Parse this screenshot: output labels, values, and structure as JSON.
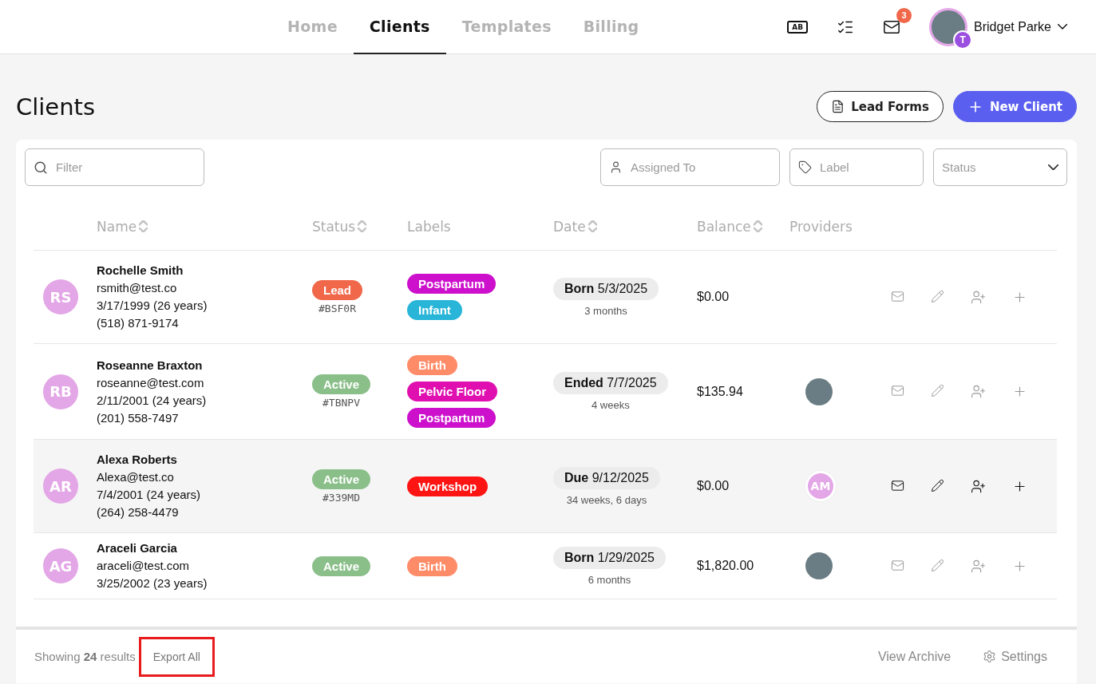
{
  "nav": {
    "tabs": [
      {
        "label": "Home",
        "selected": false
      },
      {
        "label": "Clients",
        "selected": true
      },
      {
        "label": "Templates",
        "selected": false
      },
      {
        "label": "Billing",
        "selected": false
      }
    ],
    "ab_icon_label": "AB",
    "mail_badge": "3",
    "user": {
      "name": "Bridget Parke",
      "badge": "T"
    }
  },
  "page": {
    "title": "Clients",
    "buttons": [
      {
        "label": "Lead Forms",
        "kind": "outline"
      },
      {
        "label": "New Client",
        "kind": "primary"
      }
    ]
  },
  "filters": {
    "search": {
      "placeholder": "Filter"
    },
    "assigned_to": {
      "placeholder": "Assigned To"
    },
    "label": {
      "placeholder": "Label"
    },
    "status": {
      "placeholder": "Status"
    }
  },
  "table": {
    "columns": [
      {
        "label": "Name",
        "sortable": true
      },
      {
        "label": "Status",
        "sortable": true
      },
      {
        "label": "Labels",
        "sortable": false
      },
      {
        "label": "Date",
        "sortable": true
      },
      {
        "label": "Balance",
        "sortable": true
      },
      {
        "label": "Providers",
        "sortable": false
      }
    ],
    "rows": [
      {
        "initials": "RS",
        "name": "Rochelle Smith",
        "email": "rsmith@test.co",
        "birth": "3/17/1999 (26 years)",
        "phone": "(518) 871-9174",
        "status": {
          "label": "Lead",
          "color": "#f0674a",
          "code": "#BSF0R"
        },
        "labels": [
          {
            "label": "Postpartum",
            "color": "#cc10cc"
          },
          {
            "label": "Infant",
            "color": "#28b5d8"
          }
        ],
        "date": {
          "kind": "Born",
          "value": "5/3/2025",
          "relative": "3 months"
        },
        "balance": "$0.00",
        "providers": [],
        "hovered": false
      },
      {
        "initials": "RB",
        "name": "Roseanne Braxton",
        "email": "roseanne@test.com",
        "birth": "2/11/2001 (24 years)",
        "phone": "(201) 558-7497",
        "status": {
          "label": "Active",
          "color": "#8bbf8a",
          "code": "#TBNPV"
        },
        "labels": [
          {
            "label": "Birth",
            "color": "#ff8c69"
          },
          {
            "label": "Pelvic Floor",
            "color": "#e010b0"
          },
          {
            "label": "Postpartum",
            "color": "#cc10cc"
          }
        ],
        "date": {
          "kind": "Ended",
          "value": "7/7/2025",
          "relative": "4 weeks"
        },
        "balance": "$135.94",
        "providers": [
          {
            "kind": "photo"
          }
        ],
        "hovered": false
      },
      {
        "initials": "AR",
        "name": "Alexa Roberts",
        "email": "Alexa@test.co",
        "birth": "7/4/2001 (24 years)",
        "phone": "(264) 258-4479",
        "status": {
          "label": "Active",
          "color": "#8bbf8a",
          "code": "#339MD"
        },
        "labels": [
          {
            "label": "Workshop",
            "color": "#ff1414"
          }
        ],
        "date": {
          "kind": "Due",
          "value": "9/12/2025",
          "relative": "34 weeks, 6 days"
        },
        "balance": "$0.00",
        "providers": [
          {
            "kind": "initials",
            "initials": "AM"
          }
        ],
        "hovered": true
      },
      {
        "initials": "AG",
        "name": "Araceli Garcia",
        "email": "araceli@test.com",
        "birth": "3/25/2002 (23 years)",
        "status": {
          "label": "Active",
          "color": "#8bbf8a"
        },
        "labels": [
          {
            "label": "Birth",
            "color": "#ff8c69"
          }
        ],
        "date": {
          "kind": "Born",
          "value": "1/29/2025",
          "relative": "6 months"
        },
        "balance": "$1,820.00",
        "providers": [
          {
            "kind": "photo"
          }
        ],
        "hovered": false
      }
    ]
  },
  "footer": {
    "summary": "Showing **24** results",
    "export": {
      "label": "Export All",
      "highlighted": true
    },
    "view_archive": "View Archive",
    "settings": "Settings"
  }
}
